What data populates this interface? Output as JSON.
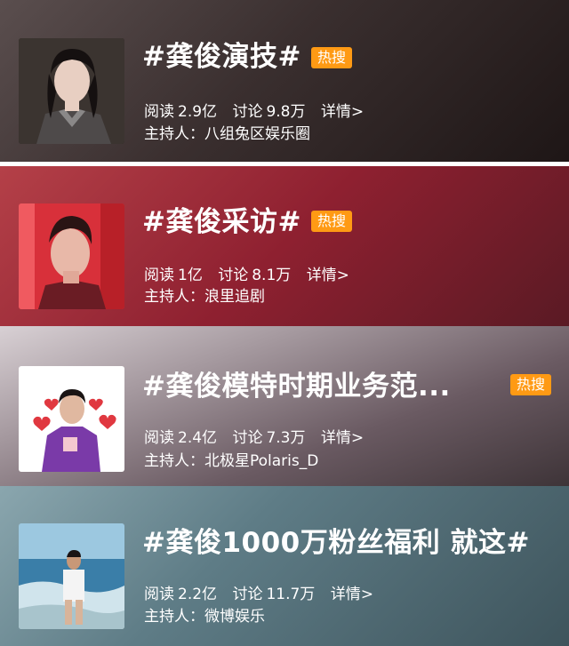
{
  "topics": [
    {
      "title": "#龚俊演技#",
      "badge": "热搜",
      "read_label": "阅读",
      "read": "2.9亿",
      "discuss_label": "讨论",
      "discuss": "9.8万",
      "detail": "详情>",
      "host_label": "主持人：",
      "host": "八组兔区娱乐圈"
    },
    {
      "title": "#龚俊采访#",
      "badge": "热搜",
      "read_label": "阅读",
      "read": "1亿",
      "discuss_label": "讨论",
      "discuss": "8.1万",
      "detail": "详情>",
      "host_label": "主持人：",
      "host": "浪里追剧"
    },
    {
      "title": "#龚俊模特时期业务范...",
      "badge": "热搜",
      "read_label": "阅读",
      "read": "2.4亿",
      "discuss_label": "讨论",
      "discuss": "7.3万",
      "detail": "详情>",
      "host_label": "主持人：",
      "host": "北极星Polaris_D"
    },
    {
      "title": "#龚俊1000万粉丝福利 就这#",
      "read_label": "阅读",
      "read": "2.2亿",
      "discuss_label": "讨论",
      "discuss": "11.7万",
      "detail": "详情>",
      "host_label": "主持人：",
      "host": "微博娱乐"
    }
  ],
  "colors": {
    "badge": "#ff9a14",
    "card1_bg": "#3a2f2e",
    "card2_bg": "#8e2030",
    "card3_bg": "#6a5a62",
    "card4_bg": "#4e6870"
  }
}
